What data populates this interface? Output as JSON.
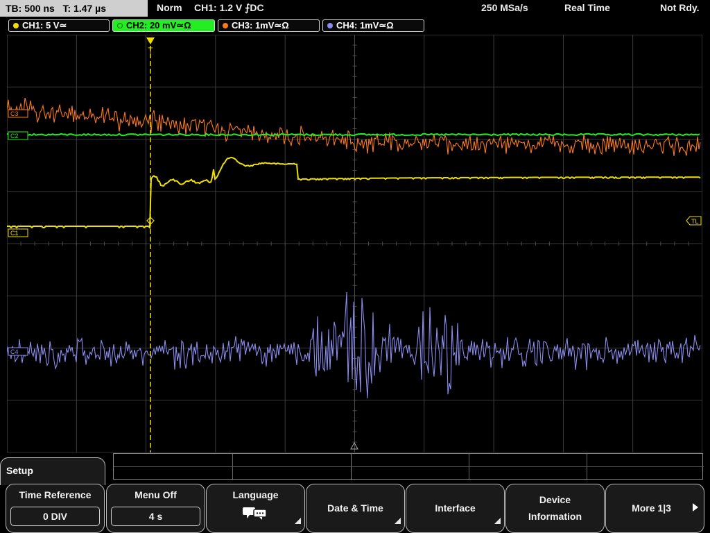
{
  "status_bar": {
    "timebase": "TB: 500 ns",
    "trigger_time": "T: 1.47 µs",
    "trigger_mode": "Norm",
    "trigger_info": "CH1: 1.2 V ⨍DC",
    "sample_rate": "250 MSa/s",
    "acq_mode": "Real Time",
    "acq_state": "Not Rdy."
  },
  "channels": [
    {
      "label": "CH1: 5 V≃",
      "color": "#f0e000",
      "bg": "#0a0a0a",
      "text": "#ffffff",
      "dot": "#f0e000"
    },
    {
      "label": "CH2: 20 mV≃Ω",
      "color": "#22ee22",
      "bg": "#22ee22",
      "text": "#000000",
      "dot": "#22ee22"
    },
    {
      "label": "CH3: 1mV≃Ω",
      "color": "#ff7a1a",
      "bg": "#0a0a0a",
      "text": "#ffffff",
      "dot": "#ff7a1a"
    },
    {
      "label": "CH4: 1mV≃Ω",
      "color": "#8c8cf0",
      "bg": "#0a0a0a",
      "text": "#ffffff",
      "dot": "#8c8cf0"
    }
  ],
  "markers": {
    "c1": "C1",
    "c2": "C2",
    "c3": "C3",
    "c4": "C4",
    "trigger_level": "TL"
  },
  "menu": {
    "title": "Setup",
    "softkeys": [
      {
        "label": "Time Reference",
        "value": "0 DIV"
      },
      {
        "label": "Menu Off",
        "value": "4 s"
      },
      {
        "label": "Language",
        "icon": "speech-bubbles-icon"
      },
      {
        "label": "Date & Time"
      },
      {
        "label": "Interface"
      },
      {
        "label1": "Device",
        "label2": "Information"
      },
      {
        "label": "More 1|3"
      }
    ]
  },
  "colors": {
    "grid": "#4a4a4a",
    "trigger_marker": "#f0e000",
    "panel_border": "#bdbdbd"
  }
}
